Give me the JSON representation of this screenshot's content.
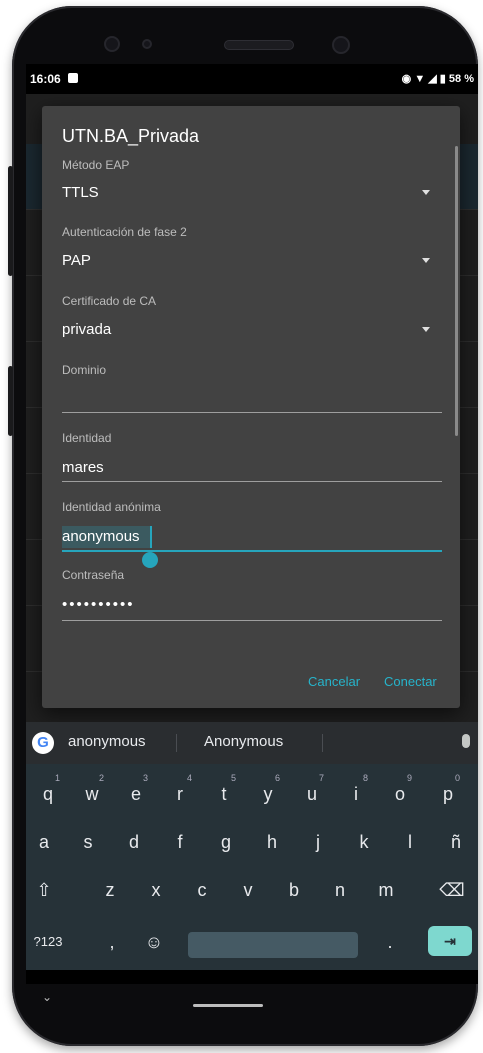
{
  "status_bar": {
    "time": "16:06",
    "battery": "58 %",
    "icons": [
      "eye-icon",
      "wifi-icon",
      "signal-icon",
      "battery-icon"
    ]
  },
  "dialog": {
    "title": "UTN.BA_Privada",
    "fields": {
      "eap_method": {
        "label": "Método EAP",
        "value": "TTLS"
      },
      "phase2_auth": {
        "label": "Autenticación de fase 2",
        "value": "PAP"
      },
      "ca_cert": {
        "label": "Certificado de CA",
        "value": "privada"
      },
      "domain": {
        "label": "Dominio",
        "value": ""
      },
      "identity": {
        "label": "Identidad",
        "value": "mares"
      },
      "anonymous_identity": {
        "label": "Identidad anónima",
        "value": "anonymous"
      },
      "password": {
        "label": "Contraseña",
        "value": "••••••••••"
      }
    },
    "buttons": {
      "cancel": "Cancelar",
      "connect": "Conectar"
    }
  },
  "keyboard": {
    "suggestions": [
      "anonymous",
      "Anonymous"
    ],
    "row1": [
      "q",
      "w",
      "e",
      "r",
      "t",
      "y",
      "u",
      "i",
      "o",
      "p"
    ],
    "row1_hints": [
      "1",
      "2",
      "3",
      "4",
      "5",
      "6",
      "7",
      "8",
      "9",
      "0"
    ],
    "row2": [
      "a",
      "s",
      "d",
      "f",
      "g",
      "h",
      "j",
      "k",
      "l",
      "ñ"
    ],
    "row3": [
      "z",
      "x",
      "c",
      "v",
      "b",
      "n",
      "m"
    ],
    "symbols_key": "?123",
    "comma_key": ",",
    "period_key": ".",
    "shift_key": "⇧",
    "backspace_key": "⌫",
    "emoji_key": "☺",
    "enter_key": "⇥"
  },
  "colors": {
    "accent": "#26a5bc",
    "dialog_bg": "#424242",
    "keyboard_bg": "#263238"
  }
}
